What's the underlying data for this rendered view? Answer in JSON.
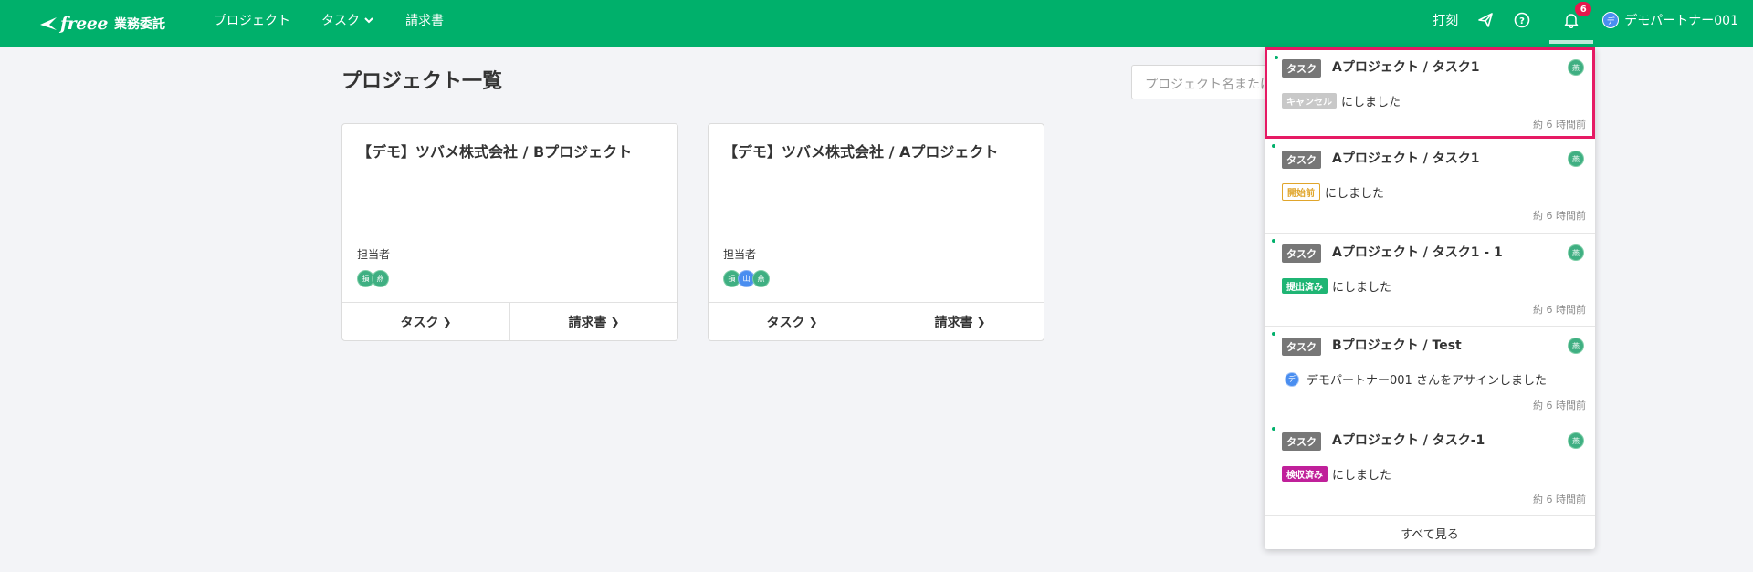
{
  "header": {
    "logo_text": "freee",
    "logo_sub": "業務委託",
    "nav": [
      "プロジェクト",
      "タスク",
      "請求書"
    ],
    "clock_label": "打刻",
    "notification_count": "6",
    "user_initial": "デ",
    "user_name": "デモパートナー001"
  },
  "main": {
    "title": "プロジェクト一覧",
    "search_placeholder": "プロジェクト名または",
    "cards": [
      {
        "title": "【デモ】ツバメ株式会社 / Bプロジェクト",
        "owner_label": "担当者",
        "avatars": [
          "損",
          "燕"
        ],
        "btn_task": "タスク",
        "btn_invoice": "請求書"
      },
      {
        "title": "【デモ】ツバメ株式会社 / Aプロジェクト",
        "owner_label": "担当者",
        "avatars": [
          "損",
          "山",
          "燕"
        ],
        "btn_task": "タスク",
        "btn_invoice": "請求書"
      }
    ]
  },
  "notifications": {
    "items": [
      {
        "tag": "タスク",
        "title": "Aプロジェクト / タスク1",
        "avatar": "燕",
        "status": "キャンセル",
        "text": "にしました",
        "time": "約 6 時間前"
      },
      {
        "tag": "タスク",
        "title": "Aプロジェクト / タスク1",
        "avatar": "燕",
        "status": "開始前",
        "text": "にしました",
        "time": "約 6 時間前"
      },
      {
        "tag": "タスク",
        "title": "Aプロジェクト / タスク1 - 1",
        "avatar": "燕",
        "status": "提出済み",
        "text": "にしました",
        "time": "約 6 時間前"
      },
      {
        "tag": "タスク",
        "title": "Bプロジェクト / Test",
        "avatar": "燕",
        "assignee_initial": "デ",
        "text": "デモパートナー001 さんをアサインしました",
        "time": "約 6 時間前"
      },
      {
        "tag": "タスク",
        "title": "Aプロジェクト / タスク-1",
        "avatar": "燕",
        "status": "検収済み",
        "text": "にしました",
        "time": "約 6 時間前"
      }
    ],
    "see_all": "すべて見る"
  }
}
